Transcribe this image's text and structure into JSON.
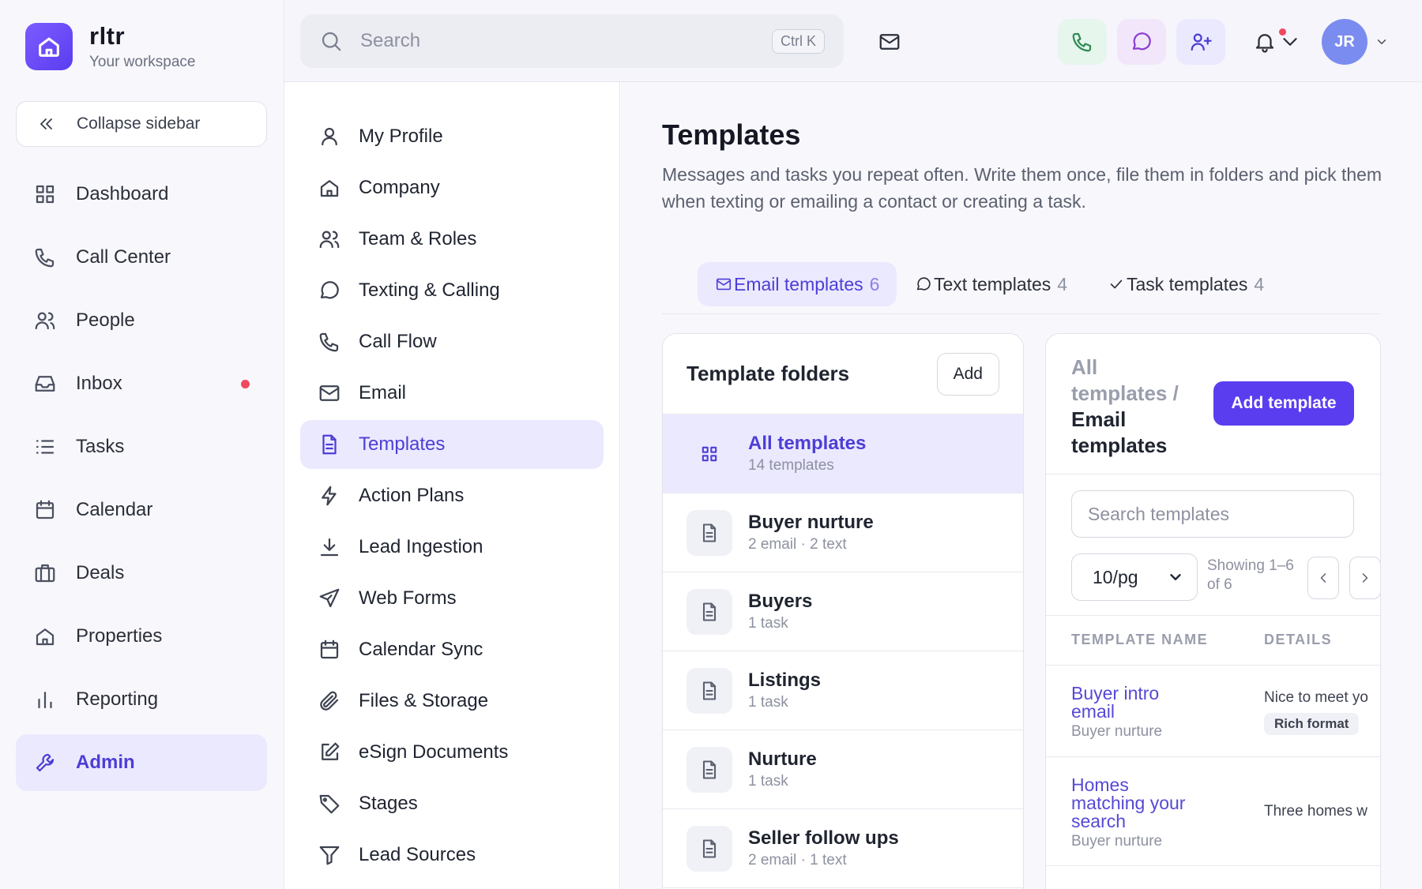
{
  "brand": {
    "name": "rltr",
    "subtitle": "Your workspace"
  },
  "sidebar": {
    "collapse_label": "Collapse sidebar",
    "items": [
      {
        "label": "Dashboard",
        "icon": "grid-icon"
      },
      {
        "label": "Call Center",
        "icon": "phone-icon"
      },
      {
        "label": "People",
        "icon": "users-icon"
      },
      {
        "label": "Inbox",
        "icon": "inbox-icon",
        "unread_dot": true
      },
      {
        "label": "Tasks",
        "icon": "list-icon"
      },
      {
        "label": "Calendar",
        "icon": "calendar-icon"
      },
      {
        "label": "Deals",
        "icon": "briefcase-icon"
      },
      {
        "label": "Properties",
        "icon": "home-icon"
      },
      {
        "label": "Reporting",
        "icon": "bar-chart-icon"
      },
      {
        "label": "Admin",
        "icon": "wrench-icon",
        "active": true
      }
    ]
  },
  "topbar": {
    "search_placeholder": "Search",
    "shortcut": "Ctrl K",
    "avatar_initials": "JR"
  },
  "settings_menu": {
    "items": [
      {
        "label": "My Profile",
        "icon": "user-icon"
      },
      {
        "label": "Company",
        "icon": "building-icon"
      },
      {
        "label": "Team & Roles",
        "icon": "team-icon"
      },
      {
        "label": "Texting & Calling",
        "icon": "message-icon"
      },
      {
        "label": "Call Flow",
        "icon": "phone-icon"
      },
      {
        "label": "Email",
        "icon": "mail-icon"
      },
      {
        "label": "Templates",
        "icon": "document-icon",
        "active": true
      },
      {
        "label": "Action Plans",
        "icon": "lightning-icon"
      },
      {
        "label": "Lead Ingestion",
        "icon": "download-icon"
      },
      {
        "label": "Web Forms",
        "icon": "send-icon"
      },
      {
        "label": "Calendar Sync",
        "icon": "calendar-icon"
      },
      {
        "label": "Files & Storage",
        "icon": "paperclip-icon"
      },
      {
        "label": "eSign Documents",
        "icon": "edit-icon"
      },
      {
        "label": "Stages",
        "icon": "tag-icon"
      },
      {
        "label": "Lead Sources",
        "icon": "filter-icon"
      }
    ]
  },
  "page": {
    "title": "Templates",
    "description": "Messages and tasks you repeat often. Write them once, file them in folders and pick them when texting or emailing a contact or creating a task."
  },
  "tabs": [
    {
      "label": "Email templates",
      "count": "6",
      "icon": "mail-icon",
      "active": true
    },
    {
      "label": "Text templates",
      "count": "4",
      "icon": "message-icon"
    },
    {
      "label": "Task templates",
      "count": "4",
      "icon": "check-icon"
    }
  ],
  "folders": {
    "title": "Template folders",
    "add_label": "Add",
    "items": [
      {
        "name": "All templates",
        "sub": "14 templates",
        "active": true,
        "icon": "grid-icon"
      },
      {
        "name": "Buyer nurture",
        "sub": "2 email · 2 text",
        "icon": "document-icon"
      },
      {
        "name": "Buyers",
        "sub": "1 task",
        "icon": "document-icon"
      },
      {
        "name": "Listings",
        "sub": "1 task",
        "icon": "document-icon"
      },
      {
        "name": "Nurture",
        "sub": "1 task",
        "icon": "document-icon"
      },
      {
        "name": "Seller follow ups",
        "sub": "2 email · 1 text",
        "icon": "document-icon"
      }
    ]
  },
  "templates_panel": {
    "breadcrumb_root": "All templates /",
    "breadcrumb_current": "Email templates",
    "add_label": "Add template",
    "search_placeholder": "Search templates",
    "page_size": "10/pg",
    "showing": "Showing 1–6 of 6",
    "columns": [
      "TEMPLATE NAME",
      "DETAILS"
    ],
    "rows": [
      {
        "name": "Buyer intro email",
        "folder": "Buyer nurture",
        "detail": "Nice to meet yo",
        "badge": "Rich format"
      },
      {
        "name": "Homes matching your search",
        "folder": "Buyer nurture",
        "detail": "Three homes w"
      }
    ]
  },
  "colors": {
    "accent": "#5b3df0",
    "accent_soft": "#ebe9fe",
    "alert": "#ef4a5f"
  }
}
